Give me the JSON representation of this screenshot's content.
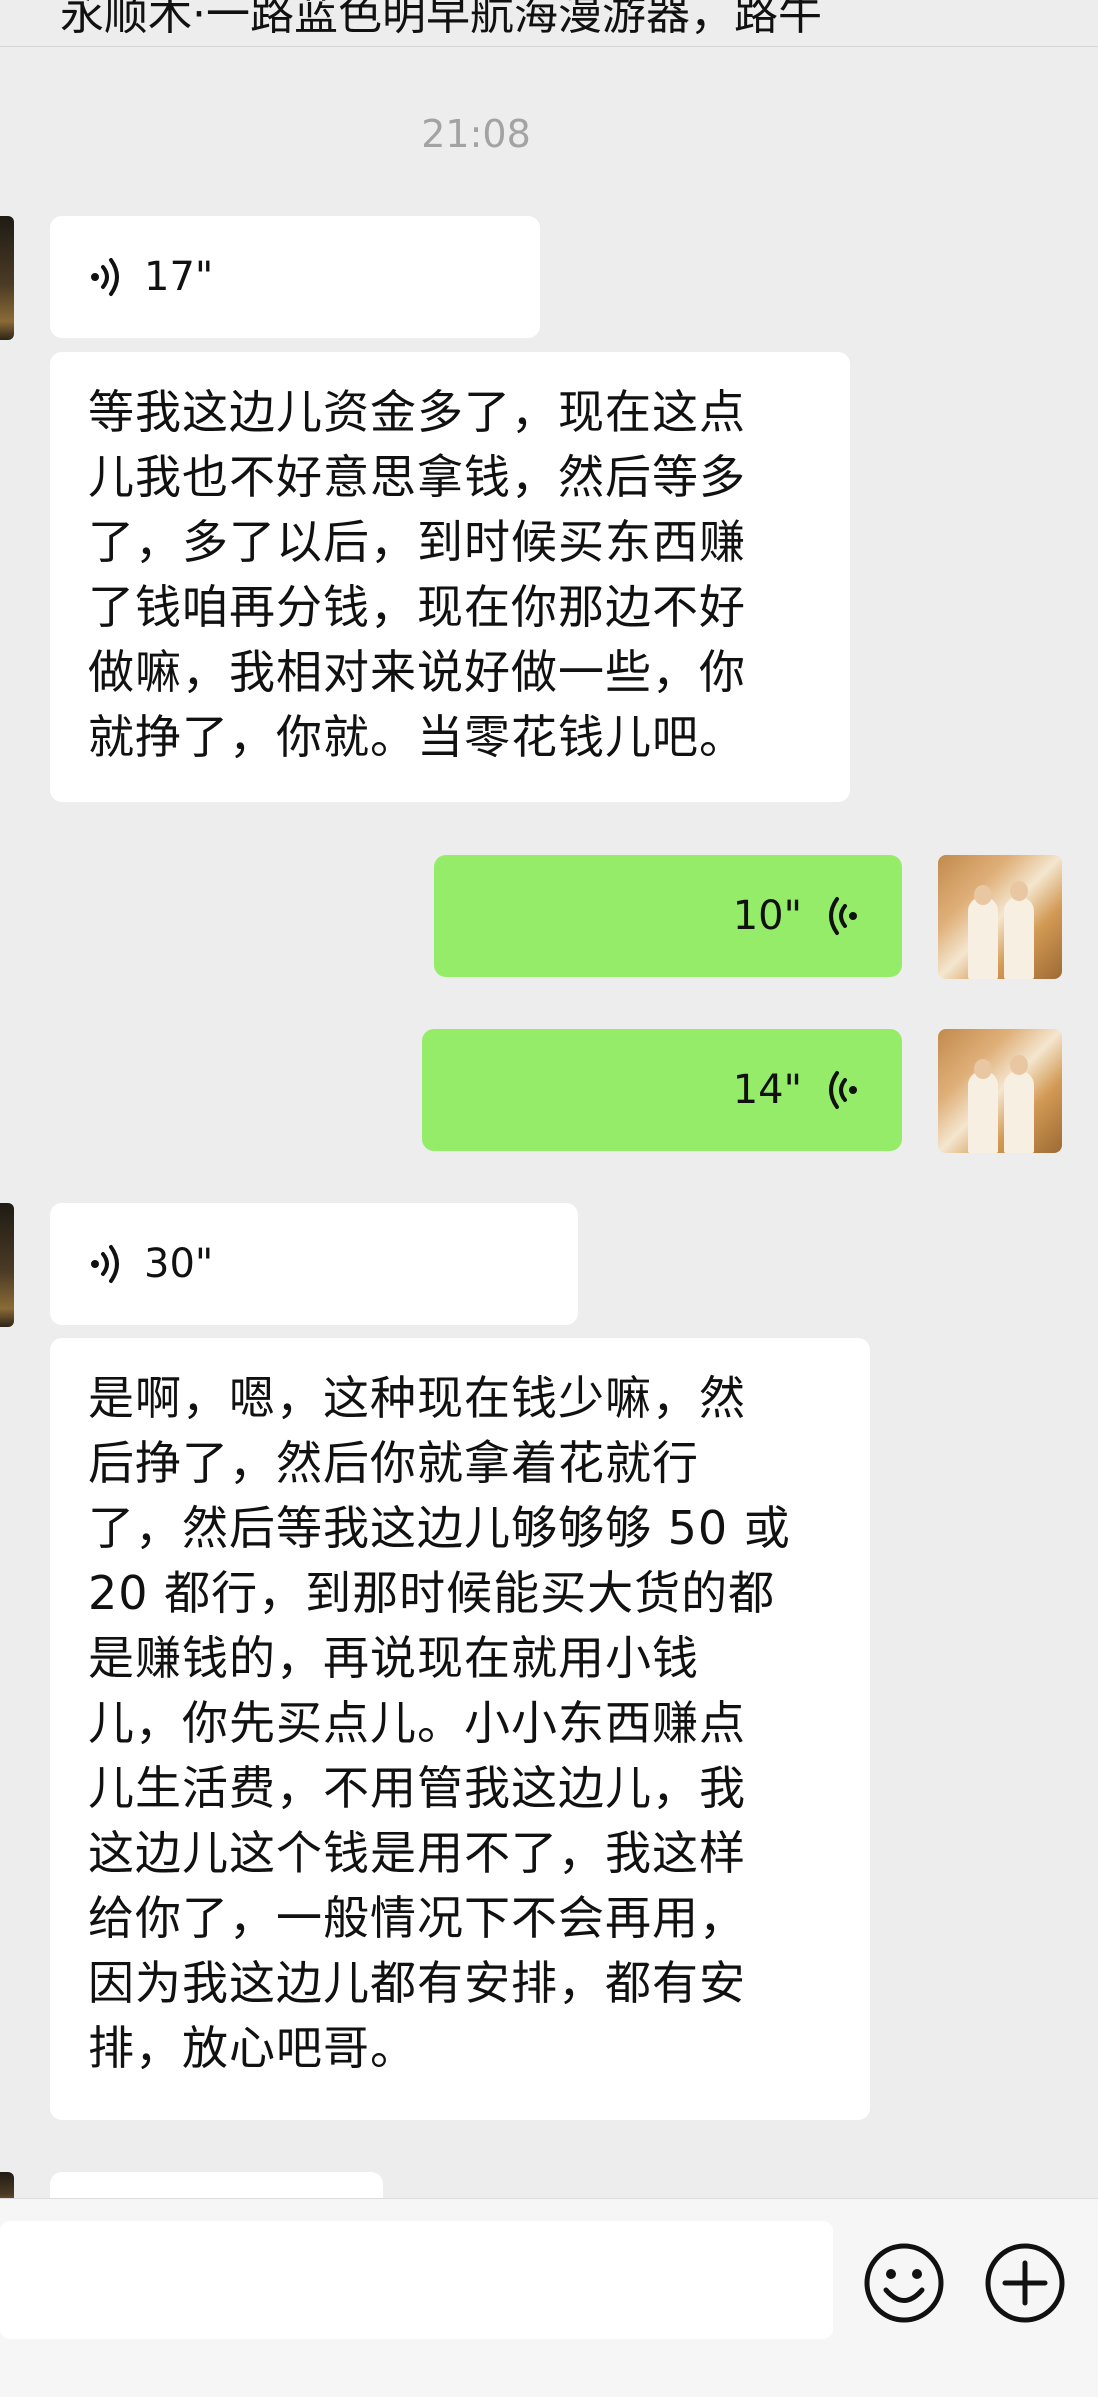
{
  "header": {
    "title": "永顺木·一路蓝色明早航海漫游器，路牛"
  },
  "chat": {
    "timestamp": "21:08",
    "messages": [
      {
        "sender": "other",
        "kind": "voice",
        "duration": "17\""
      },
      {
        "sender": "other",
        "kind": "text",
        "lines": [
          "等我这边儿资金多了，现在这点",
          "儿我也不好意思拿钱，然后等多",
          "了，多了以后，到时候买东西赚",
          "了钱咱再分钱，现在你那边不好",
          "做嘛，我相对来说好做一些，你",
          "就挣了，你就。当零花钱儿吧。"
        ]
      },
      {
        "sender": "me",
        "kind": "voice",
        "duration": "10\""
      },
      {
        "sender": "me",
        "kind": "voice",
        "duration": "14\""
      },
      {
        "sender": "other",
        "kind": "voice",
        "duration": "30\""
      },
      {
        "sender": "other",
        "kind": "text",
        "lines": [
          "是啊，嗯，这种现在钱少嘛，然",
          "后挣了，然后你就拿着花就行",
          "了，然后等我这边儿够够够 50 或",
          "20 都行，到那时候能买大货的都",
          "是赚钱的，再说现在就用小钱",
          "儿，你先买点儿。小小东西赚点",
          "儿生活费，不用管我这边儿，我",
          "这边儿这个钱是用不了，我这样",
          "给你了，一般情况下不会再用，",
          "因为我这边儿都有安排，都有安",
          "排，放心吧哥。"
        ]
      }
    ]
  },
  "input": {
    "value": ""
  },
  "icons": {
    "emoji": "emoji-icon",
    "plus": "plus-icon"
  },
  "colors": {
    "background": "#ededed",
    "incoming_bubble": "#ffffff",
    "outgoing_bubble": "#95ec69"
  }
}
